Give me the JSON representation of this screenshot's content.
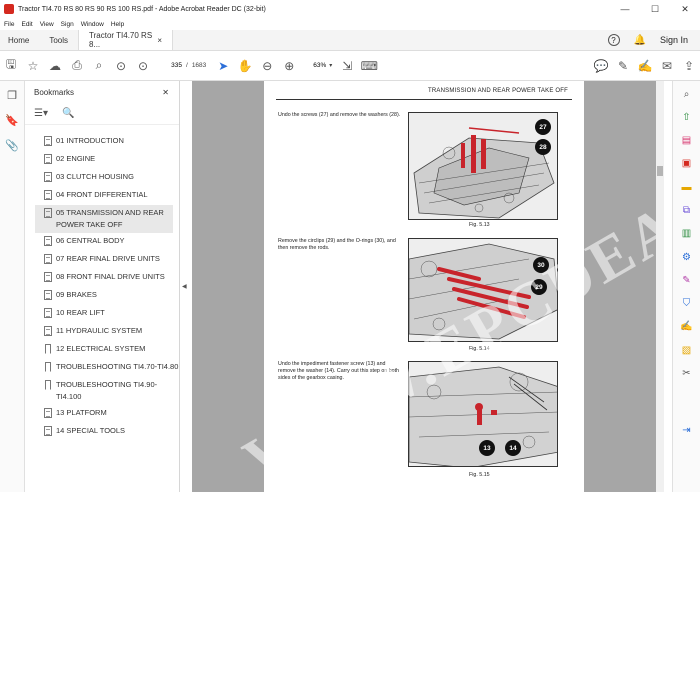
{
  "window": {
    "title": "Tractor TI4.70 RS 80 RS 90 RS 100 RS.pdf - Adobe Acrobat Reader DC (32-bit)",
    "controls": [
      "—",
      "☐",
      "✕"
    ]
  },
  "menu": [
    "File",
    "Edit",
    "View",
    "Sign",
    "Window",
    "Help"
  ],
  "tabs": {
    "home": "Home",
    "tools": "Tools",
    "document": "Tractor TI4.70 RS 8...",
    "close": "×",
    "sign_in": "Sign In"
  },
  "toolbar": {
    "current_page": "335",
    "page_separator": "/",
    "total_pages": "1683",
    "zoom": "63%"
  },
  "bookmarks": {
    "title": "Bookmarks",
    "close": "✕",
    "items": [
      {
        "label": "01 INTRODUCTION",
        "icon": "doc"
      },
      {
        "label": "02 ENGINE",
        "icon": "doc"
      },
      {
        "label": "03 CLUTCH HOUSING",
        "icon": "doc"
      },
      {
        "label": "04 FRONT DIFFERENTIAL",
        "icon": "doc"
      },
      {
        "label": "05 TRANSMISSION AND REAR POWER TAKE OFF",
        "icon": "doc",
        "selected": true
      },
      {
        "label": "06 CENTRAL BODY",
        "icon": "doc"
      },
      {
        "label": "07 REAR FINAL DRIVE UNITS",
        "icon": "doc"
      },
      {
        "label": "08 FRONT FINAL DRIVE UNITS",
        "icon": "doc"
      },
      {
        "label": "09 BRAKES",
        "icon": "doc"
      },
      {
        "label": "10 REAR LIFT",
        "icon": "doc"
      },
      {
        "label": "11 HYDRAULIC SYSTEM",
        "icon": "doc"
      },
      {
        "label": "12 ELECTRICAL SYSTEM",
        "icon": "flag"
      },
      {
        "label": "TROUBLESHOOTING TI4.70-TI4.80",
        "icon": "flag"
      },
      {
        "label": "TROUBLESHOOTING TI4.90-TI4.100",
        "icon": "flag"
      },
      {
        "label": "13 PLATFORM",
        "icon": "doc"
      },
      {
        "label": "14 SPECIAL TOOLS",
        "icon": "doc"
      }
    ]
  },
  "page": {
    "header": "TRANSMISSION AND REAR POWER TAKE OFF",
    "watermark": "WWW.EPCDEAL.COM",
    "steps": [
      {
        "text": "Undo the screws (27) and remove the washers (28).",
        "figure": "Fig. 5.13",
        "callouts": [
          "27",
          "28"
        ]
      },
      {
        "text": "Remove the circlips (29) and the O-rings (30), and then remove the rods.",
        "figure": "Fig. 5.14",
        "callouts": [
          "30",
          "29"
        ]
      },
      {
        "text": "Undo the impediment fastener screw (13) and remove the washer (14). Carry out this step on both sides of the gearbox casing.",
        "figure": "Fig. 5.15",
        "callouts": [
          "13",
          "14"
        ]
      }
    ]
  },
  "colors": {
    "accent": "#2c6fd8",
    "pdf_red": "#d4291f",
    "doc_background": "#a6a6a6",
    "part_highlight": "#c8242b"
  }
}
